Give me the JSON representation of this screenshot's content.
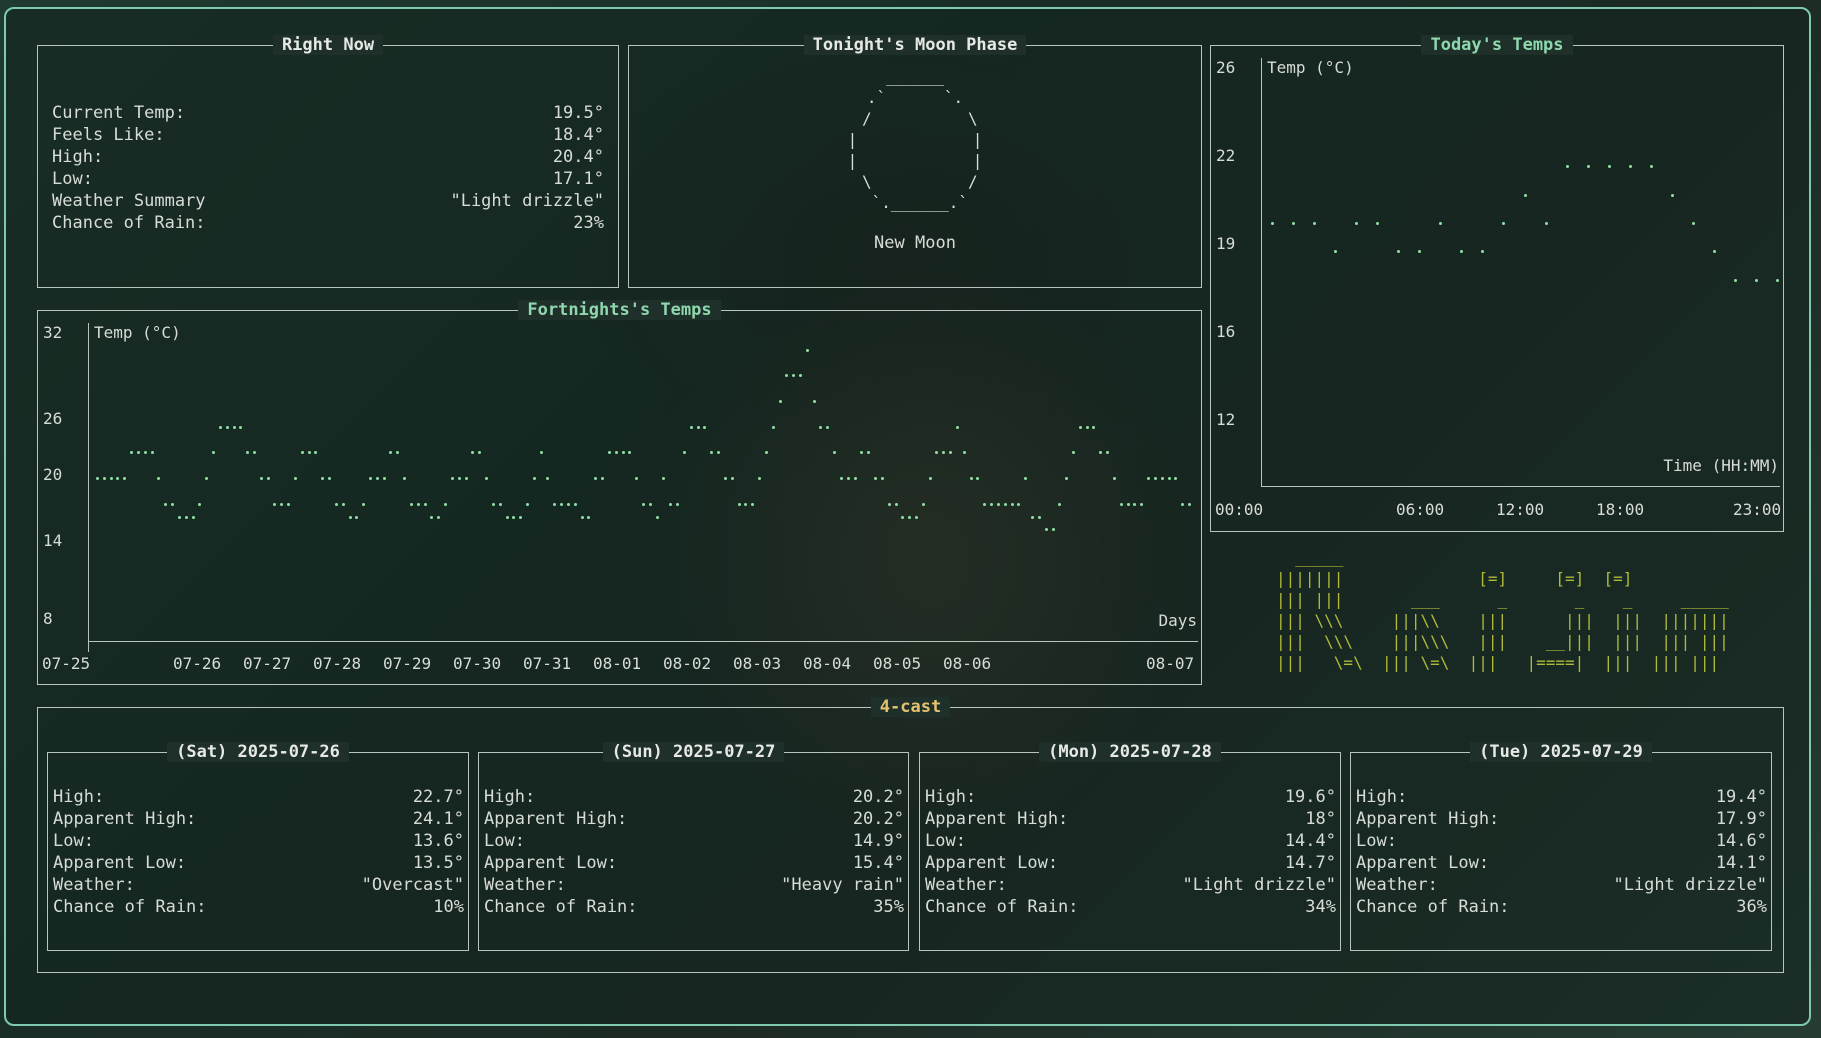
{
  "colors": {
    "accent": "#7fc9b0",
    "dots": "#8fe0a4",
    "gold": "#e6c270",
    "art": "#b0ba3a"
  },
  "right_now": {
    "title": "Right Now",
    "rows": [
      {
        "label": "Current Temp:",
        "value": "19.5°"
      },
      {
        "label": "Feels Like:",
        "value": "18.4°"
      },
      {
        "label": "High:",
        "value": "20.4°"
      },
      {
        "label": "Low:",
        "value": "17.1°"
      },
      {
        "label": "Weather Summary",
        "value": "\"Light drizzle\""
      },
      {
        "label": "Chance of Rain:",
        "value": "23%"
      }
    ]
  },
  "moon": {
    "title": "Tonight's Moon Phase",
    "art": "  ______  \n .`      `. \n /          \\\n|            |\n|            |\n \\          /\n  `.______.` ",
    "name": "New Moon"
  },
  "today": {
    "title": "Today's Temps",
    "ylabel": "Temp (°C)",
    "xlabel": "Time (HH:MM)",
    "y_ticks": [
      "26",
      "22",
      "19",
      "16",
      "12"
    ],
    "x_ticks": [
      "00:00",
      "06:00",
      "12:00",
      "18:00",
      "23:00"
    ]
  },
  "fortnight": {
    "title": "Fortnights's Temps",
    "ylabel": "Temp (°C)",
    "xlabel": "Days",
    "y_ticks": [
      "32",
      "26",
      "20",
      "14",
      "8"
    ],
    "x_ticks": [
      "07-25",
      "07-26",
      "07-27",
      "07-28",
      "07-29",
      "07-30",
      "07-31",
      "08-01",
      "08-02",
      "08-03",
      "08-04",
      "08-05",
      "08-06",
      "08-07"
    ]
  },
  "logo_art": "  _____\n|||||||              [=]     [=]  [=]\n||| |||       ___      _       _    _     _____\n||| \\\\\\     |||\\\\    |||      |||  |||  |||||||\n|||  \\\\\\    |||\\\\\\   |||    __|||  |||  ||| |||\n|||   \\=\\  ||| \\=\\  |||   |====|  |||  ||| |||",
  "forecast": {
    "title": "4-cast",
    "days": [
      {
        "title": "(Sat) 2025-07-26",
        "rows": [
          {
            "label": "High:",
            "value": "22.7°"
          },
          {
            "label": "Apparent High:",
            "value": "24.1°"
          },
          {
            "label": "Low:",
            "value": "13.6°"
          },
          {
            "label": "Apparent Low:",
            "value": "13.5°"
          },
          {
            "label": "Weather:",
            "value": "\"Overcast\""
          },
          {
            "label": "Chance of Rain:",
            "value": "10%"
          }
        ]
      },
      {
        "title": "(Sun) 2025-07-27",
        "rows": [
          {
            "label": "High:",
            "value": "20.2°"
          },
          {
            "label": "Apparent High:",
            "value": "20.2°"
          },
          {
            "label": "Low:",
            "value": "14.9°"
          },
          {
            "label": "Apparent Low:",
            "value": "15.4°"
          },
          {
            "label": "Weather:",
            "value": "\"Heavy rain\""
          },
          {
            "label": "Chance of Rain:",
            "value": "35%"
          }
        ]
      },
      {
        "title": "(Mon) 2025-07-28",
        "rows": [
          {
            "label": "High:",
            "value": "19.6°"
          },
          {
            "label": "Apparent High:",
            "value": "18°"
          },
          {
            "label": "Low:",
            "value": "14.4°"
          },
          {
            "label": "Apparent Low:",
            "value": "14.7°"
          },
          {
            "label": "Weather:",
            "value": "\"Light drizzle\""
          },
          {
            "label": "Chance of Rain:",
            "value": "34%"
          }
        ]
      },
      {
        "title": "(Tue) 2025-07-29",
        "rows": [
          {
            "label": "High:",
            "value": "19.4°"
          },
          {
            "label": "Apparent High:",
            "value": "17.9°"
          },
          {
            "label": "Low:",
            "value": "14.6°"
          },
          {
            "label": "Apparent Low:",
            "value": "14.1°"
          },
          {
            "label": "Weather:",
            "value": "\"Light drizzle\""
          },
          {
            "label": "Chance of Rain:",
            "value": "36%"
          }
        ]
      }
    ]
  },
  "chart_data": [
    {
      "type": "scatter",
      "title": "Today's Temps",
      "xlabel": "Time (HH:MM)",
      "ylabel": "Temp (°C)",
      "x": [
        "00:00",
        "01:00",
        "02:00",
        "03:00",
        "04:00",
        "05:00",
        "06:00",
        "07:00",
        "08:00",
        "09:00",
        "10:00",
        "11:00",
        "12:00",
        "13:00",
        "14:00",
        "15:00",
        "16:00",
        "17:00",
        "18:00",
        "19:00",
        "20:00",
        "21:00",
        "22:00",
        "23:00",
        "23:30"
      ],
      "values": [
        19,
        19,
        19,
        18,
        19,
        19,
        18,
        18,
        19,
        18,
        18,
        19,
        20,
        19,
        21,
        21,
        21,
        21,
        21,
        20,
        19,
        18,
        17,
        17,
        17
      ],
      "ylim": [
        12,
        26
      ],
      "grid": false
    },
    {
      "type": "scatter",
      "title": "Fortnights's Temps",
      "xlabel": "Days",
      "ylabel": "Temp (°C)",
      "series": [
        {
          "values": [
            20,
            20,
            20,
            20,
            20,
            22,
            22,
            22,
            22,
            20,
            18,
            18,
            17,
            17,
            17,
            18,
            20,
            22,
            24,
            24,
            24,
            24,
            22,
            22,
            20,
            20,
            18,
            18,
            18,
            20,
            22,
            22,
            22,
            20,
            20,
            18,
            18,
            17,
            17,
            18,
            20,
            20,
            20,
            22,
            22,
            20,
            18,
            18,
            18,
            17,
            17,
            18,
            20,
            20,
            20,
            22,
            22,
            20,
            18,
            18,
            17,
            17,
            17,
            18,
            20,
            22,
            20,
            18,
            18,
            18,
            18,
            17,
            17,
            20,
            20,
            22,
            22,
            22,
            22,
            20,
            18,
            18,
            17,
            20,
            18,
            18,
            22,
            24,
            24,
            24,
            22,
            22,
            20,
            20,
            18,
            18,
            18,
            20,
            22,
            24,
            26,
            28,
            28,
            28,
            30,
            26,
            24,
            24,
            22,
            20,
            20,
            20,
            22,
            22,
            20,
            20,
            18,
            18,
            17,
            17,
            17,
            18,
            20,
            22,
            22,
            22,
            24,
            22,
            20,
            20,
            18,
            18,
            18,
            18,
            18,
            18,
            20,
            17,
            17,
            16,
            16,
            18,
            20,
            22,
            24,
            24,
            24,
            22,
            22,
            20,
            18,
            18,
            18,
            18,
            20,
            20,
            20,
            20,
            20,
            18,
            18
          ]
        }
      ],
      "categories": [
        "07-25",
        "07-26",
        "07-27",
        "07-28",
        "07-29",
        "07-30",
        "07-31",
        "08-01",
        "08-02",
        "08-03",
        "08-04",
        "08-05",
        "08-06",
        "08-07"
      ],
      "ylim": [
        8,
        32
      ],
      "grid": false
    }
  ]
}
